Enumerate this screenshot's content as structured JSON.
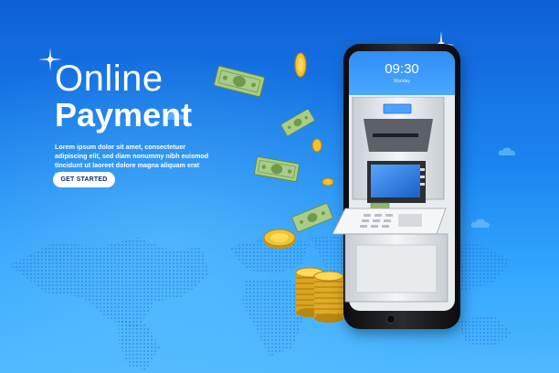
{
  "hero": {
    "title_line1": "Online",
    "title_line2": "Payment",
    "description": "Lorem ipsum dolor sit amet, consectetuer adipiscing elit, sed diam nonummy nibh euismod tincidunt ut laoreet dolore magna aliquam erat volutpat."
  },
  "cta": {
    "label": "GET STARTED"
  },
  "phone": {
    "time": "09:30",
    "day": "Monday"
  },
  "colors": {
    "background_top": "#0f5fd6",
    "background_bottom": "#4fb8ff",
    "phone_body": "#1a1b20",
    "atm_screen": "#2f7ee8",
    "money_green": "#8fb86a",
    "coin_gold": "#f2c230"
  },
  "icons": {
    "banknote": "banknote-icon",
    "coin": "coin-icon",
    "cloud": "cloud-icon",
    "sparkle": "sparkle-icon",
    "world_map": "world-map-icon"
  }
}
